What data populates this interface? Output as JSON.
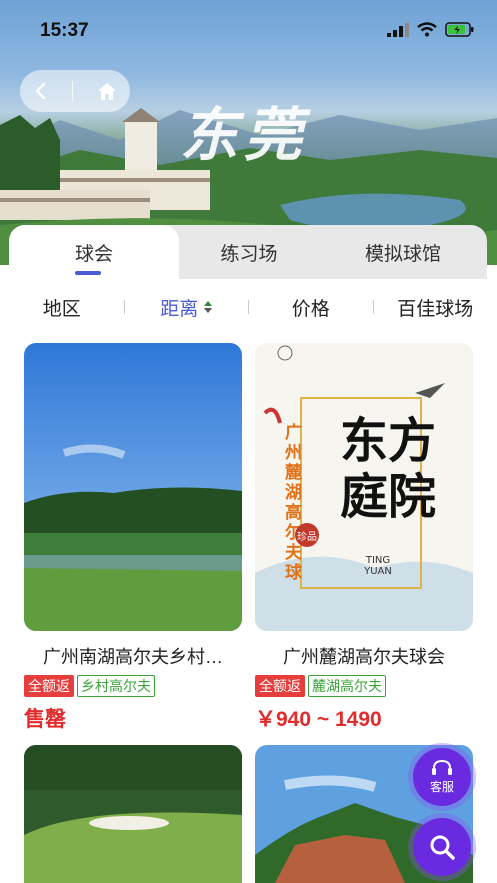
{
  "status_bar": {
    "time": "15:37"
  },
  "header": {
    "banner_text": "东莞"
  },
  "tabs": [
    {
      "label": "球会",
      "active": true
    },
    {
      "label": "练习场",
      "active": false
    },
    {
      "label": "模拟球馆",
      "active": false
    }
  ],
  "filters": [
    {
      "label": "地区"
    },
    {
      "label": "距离",
      "active": true
    },
    {
      "label": "价格"
    },
    {
      "label": "百佳球场"
    }
  ],
  "cards": [
    {
      "title": "广州南湖高尔夫乡村…",
      "tag_refund": "全额返",
      "tag_venue": "乡村高尔夫",
      "price": "售罄"
    },
    {
      "title": "广州麓湖高尔夫球会",
      "tag_refund": "全额返",
      "tag_venue": "麓湖高尔夫",
      "price": "￥940 ~ 1490",
      "poster": {
        "side_text": "广州麓湖高尔夫球",
        "main_text": "东方庭院",
        "seal": "珍品",
        "en": "TING YUAN"
      }
    }
  ],
  "floating": {
    "service_label": "客服"
  },
  "colors": {
    "accent": "#4a5bd6",
    "price_red": "#e02c2c",
    "tag_green": "#3aa33a",
    "fab": "#6a2be0"
  },
  "icons": [
    "back-icon",
    "home-icon",
    "signal-icon",
    "wifi-icon",
    "battery-icon",
    "headset-icon",
    "search-icon"
  ]
}
